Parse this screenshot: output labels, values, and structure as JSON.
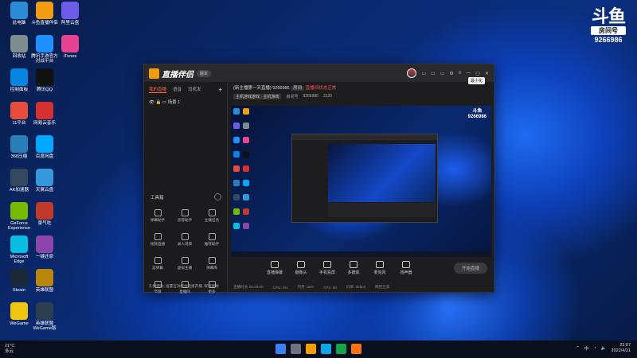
{
  "desktop": {
    "icons": [
      {
        "label": "此电脑",
        "color": "#2a8bd6"
      },
      {
        "label": "斗鱼直播伴侣",
        "color": "#f39c12"
      },
      {
        "label": "阿里云盘",
        "color": "#6c5ce7"
      },
      {
        "label": "回收站",
        "color": "#7f8c8d"
      },
      {
        "label": "腾讯手游官方\n对战平台",
        "color": "#1e90ff"
      },
      {
        "label": "iTunes",
        "color": "#e84393"
      },
      {
        "label": "控制面板",
        "color": "#0984e3"
      },
      {
        "label": "腾讯QQ",
        "color": "#111111"
      },
      {
        "label": "11平台",
        "color": "#e74c3c"
      },
      {
        "label": "网易云音乐",
        "color": "#d63031"
      },
      {
        "label": "360压缩",
        "color": "#2980b9"
      },
      {
        "label": "百度网盘",
        "color": "#00a8ff"
      },
      {
        "label": "AK加速器",
        "color": "#34495e"
      },
      {
        "label": "天翼云盘",
        "color": "#3498db"
      },
      {
        "label": "GeForce\nExperience",
        "color": "#76b900"
      },
      {
        "label": "豪气吃",
        "color": "#c0392b"
      },
      {
        "label": "Microsoft\nEdge",
        "color": "#0abde3"
      },
      {
        "label": "一键还原",
        "color": "#8e44ad"
      },
      {
        "label": "Steam",
        "color": "#1b2838"
      },
      {
        "label": "英雄联盟",
        "color": "#b8860b"
      },
      {
        "label": "WeGame",
        "color": "#f1c40f"
      },
      {
        "label": "英雄联盟\nWeGame版",
        "color": "#2c3e50"
      }
    ]
  },
  "watermark": {
    "logo": "斗鱼",
    "room_label": "房间号",
    "room_number": "9266986"
  },
  "app": {
    "brand": "直播伴侣",
    "version": "版本",
    "tabs": [
      "我的直播",
      "语音",
      "司机发"
    ],
    "scene": "场景 1",
    "tools_title": "工具箱",
    "tools": [
      {
        "label": "弹幕助手"
      },
      {
        "label": "房管助手"
      },
      {
        "label": "主播任务"
      },
      {
        "label": "视频直播"
      },
      {
        "label": "录入场景"
      },
      {
        "label": "推荐助手"
      },
      {
        "label": "滤弹幕"
      },
      {
        "label": "虚拟主播"
      },
      {
        "label": "弹幕库"
      },
      {
        "label": "节目"
      },
      {
        "label": "直播间"
      },
      {
        "label": "更多"
      }
    ],
    "tip": "礼物特效: 设置在功能中直接开播, 取消图标",
    "header": {
      "title": "(新主播第一天直播)",
      "room": "9266986",
      "tag": "房间",
      "live_status": "直播间状态正常",
      "category": "主机游戏游戏 · 主机游戏",
      "room_id_label": "房间号",
      "room_id": "9266986",
      "heat": "2120"
    },
    "controls": [
      {
        "label": "直播弹幕"
      },
      {
        "label": "摄像头"
      },
      {
        "label": "手机投屏"
      },
      {
        "label": "多媒体"
      },
      {
        "label": "麦克风"
      },
      {
        "label": "扬声器"
      }
    ],
    "start_button": "开始直播",
    "status": [
      "直播时长 00:00:00",
      "CPU: 3%",
      "内存: 32%",
      "FPS: 60",
      "码率: 0kbps",
      "网络正常"
    ],
    "tooltip": "最小化"
  },
  "taskbar": {
    "weather_temp": "21°C",
    "weather_desc": "多云",
    "time": "23:07",
    "date": "2022/4/21",
    "lang": "中",
    "apps": [
      "#3b82f6",
      "#6b7280",
      "#f59e0b",
      "#0ea5e9",
      "#16a34a",
      "#f97316"
    ]
  }
}
